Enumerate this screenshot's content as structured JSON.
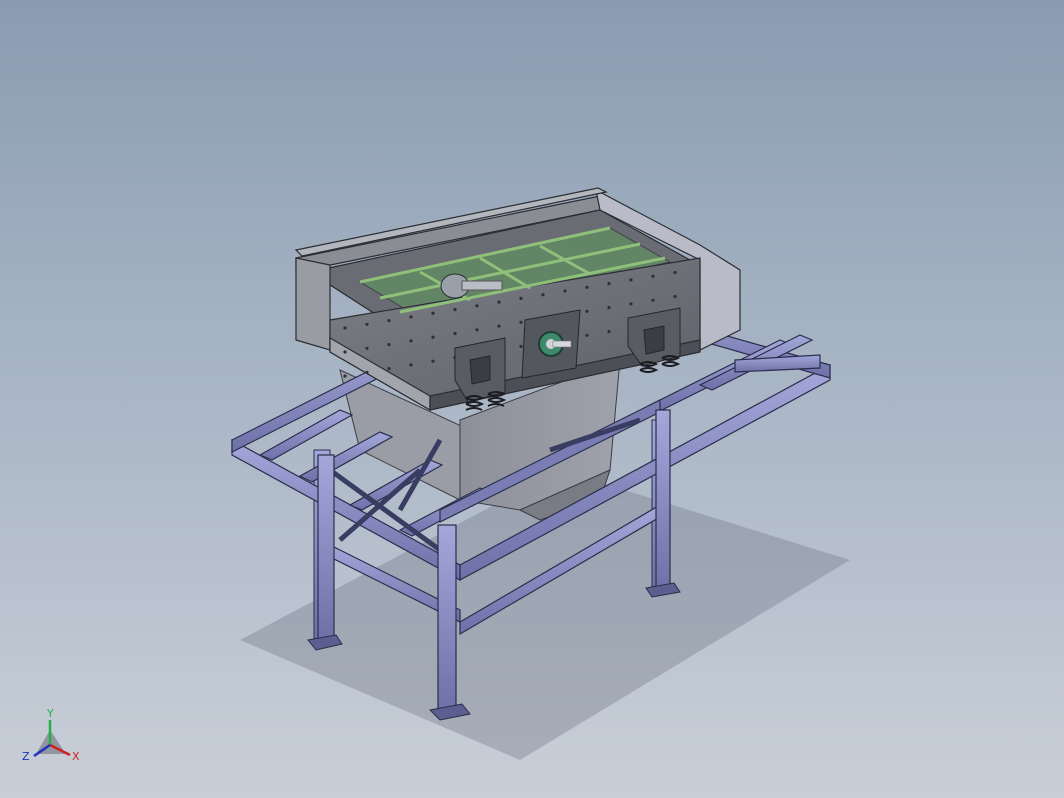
{
  "viewport": {
    "background_top": "#8a9cb2",
    "background_bottom": "#c9cfd8"
  },
  "model": {
    "frame_color": "#8c8fc4",
    "frame_edge_color": "#2a2d4a",
    "body_color": "#6f7178",
    "body_side_color": "#85878e",
    "deck_color": "#8ec07a",
    "flange_color": "#3e8a6a"
  },
  "triad": {
    "y_label": "Y",
    "x_label": "X",
    "z_label": "Z",
    "y_color": "#22b04a",
    "x_color": "#d02020",
    "z_color": "#2030c0"
  }
}
